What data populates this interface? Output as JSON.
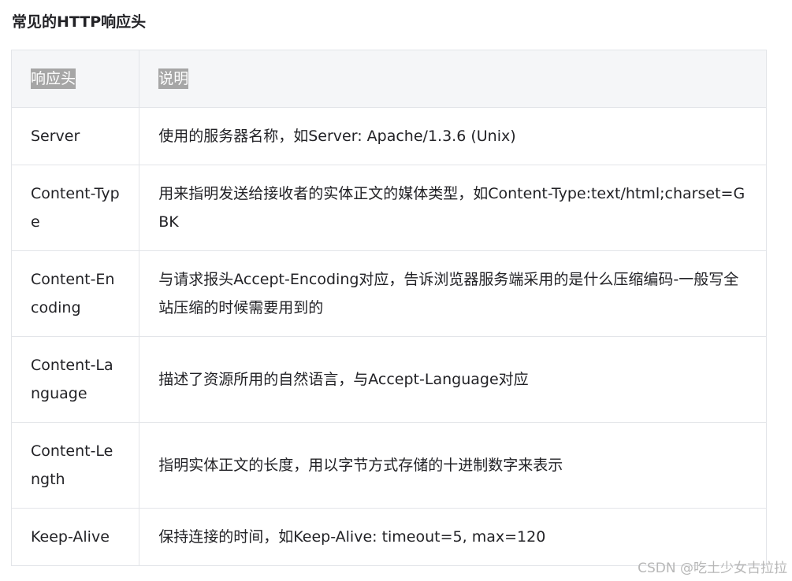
{
  "section": {
    "title": "常见的HTTP响应头"
  },
  "table": {
    "headers": [
      "响应头",
      "说明"
    ],
    "rows": [
      {
        "name": "Server",
        "desc": "使用的服务器名称，如Server: Apache/1.3.6 (Unix)"
      },
      {
        "name": "Content-Type",
        "desc": "用来指明发送给接收者的实体正文的媒体类型，如Content-Type:text/html;charset=GBK"
      },
      {
        "name": "Content-Encoding",
        "desc": "与请求报头Accept-Encoding对应，告诉浏览器服务端采用的是什么压缩编码-一般写全站压缩的时候需要用到的"
      },
      {
        "name": "Content-Language",
        "desc": "描述了资源所用的自然语言，与Accept-Language对应"
      },
      {
        "name": "Content-Length",
        "desc": "指明实体正文的长度，用以字节方式存储的十进制数字来表示"
      },
      {
        "name": "Keep-Alive",
        "desc": "保持连接的时间，如Keep-Alive: timeout=5, max=120"
      }
    ]
  },
  "watermark": "CSDN @吃土少女古拉拉"
}
